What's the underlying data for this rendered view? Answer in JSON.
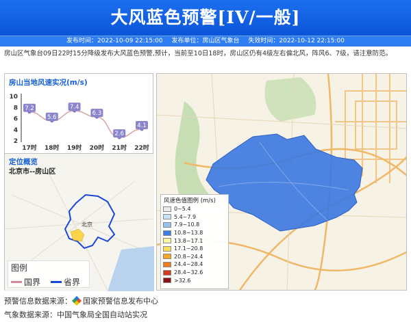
{
  "header": {
    "title": "大风蓝色预警[IV/一般]"
  },
  "meta": {
    "publish": "发布时间：2022-10-09 22:15:00",
    "unit": "发布单位：房山区气象台",
    "expire": "失效时间：2022-10-12 22:15:00"
  },
  "description": "房山区气象台09日22时15分降级发布大风蓝色预警,预计，当前至10日18时，房山区仍有4级左右偏北风，阵风6、7级，请注意防范。",
  "wind_panel": {
    "title": "房山当地风速实况(m/s)"
  },
  "chart_data": {
    "type": "line",
    "categories": [
      "17时",
      "18时",
      "19时",
      "20时",
      "21时",
      "22时"
    ],
    "values": [
      7.2,
      5.6,
      7.4,
      6.3,
      2.6,
      4.1
    ],
    "title": "房山当地风速实况(m/s)",
    "yticks": [
      2,
      4,
      6,
      8,
      10
    ],
    "ylim": [
      2,
      10
    ],
    "colors": {
      "line": "#d9a2a2",
      "label_bg": "#8b86cc",
      "point": "#6f6fc0"
    },
    "grid": false
  },
  "locate_panel": {
    "title": "定位概览",
    "subtitle": "北京市--房山区",
    "map_label": "北京",
    "legend": {
      "title": "图例",
      "items": [
        {
          "label": "国界",
          "color": "#d48a9a"
        },
        {
          "label": "省界",
          "color": "#1a45d9"
        }
      ]
    }
  },
  "wind_legend": {
    "title": "风速色值图例 (m/s)",
    "items": [
      {
        "label": "0~5.4",
        "color": "#ececec"
      },
      {
        "label": "5.4~7.9",
        "color": "#c6e3f7"
      },
      {
        "label": "7.9~10.8",
        "color": "#93c4ee"
      },
      {
        "label": "10.8~13.8",
        "color": "#3d7ee6"
      },
      {
        "label": "13.8~17.1",
        "color": "#f7f79a"
      },
      {
        "label": "17.1~20.8",
        "color": "#f7df5a"
      },
      {
        "label": "20.8~24.4",
        "color": "#f5a623"
      },
      {
        "label": "24.4~28.4",
        "color": "#ee7d1f"
      },
      {
        "label": "28.4~32.6",
        "color": "#d43a1e"
      },
      {
        "label": ">32.6",
        "color": "#8c1414"
      }
    ]
  },
  "footer": {
    "warn_source_label": "预警信息数据来源：",
    "warn_source": "国家预警信息发布中心",
    "weather_source": "气象数据来源：中国气象局全国自动站实况"
  }
}
